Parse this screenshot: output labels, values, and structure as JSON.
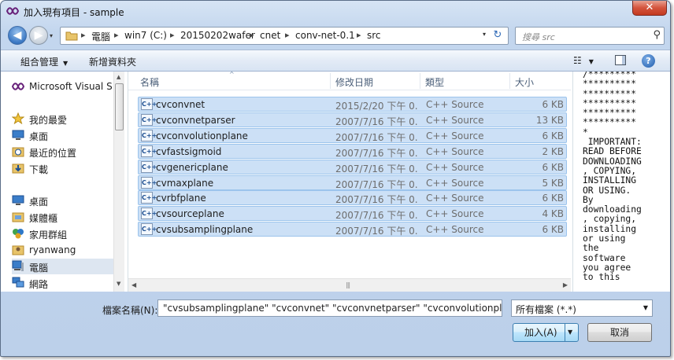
{
  "window": {
    "title": "加入現有項目 - sample",
    "close_glyph": "✕"
  },
  "navigation": {
    "back_glyph": "◀",
    "forward_glyph": "▶",
    "dropdown_glyph": "▾"
  },
  "address": {
    "segments": [
      "電腦",
      "win7 (C:)",
      "20150202wafer",
      "cnet",
      "conv-net-0.1",
      "src"
    ],
    "separator": "▸",
    "refresh_glyph": "↻",
    "dropdown_glyph": "▾"
  },
  "search": {
    "placeholder": "搜尋 src",
    "icon": "search-icon",
    "glyph": "⚲"
  },
  "toolbar": {
    "organize_label": "組合管理",
    "new_folder_label": "新增資料夾",
    "view_glyph": "☷",
    "dropdown_glyph": "▼",
    "help_glyph": "?"
  },
  "sidebar": {
    "items": [
      {
        "label": "Microsoft Visual S",
        "icon": "visual-studio-icon"
      },
      {
        "label": "我的最愛",
        "icon": "favorites-star-icon"
      },
      {
        "label": "桌面",
        "icon": "desktop-icon"
      },
      {
        "label": "最近的位置",
        "icon": "recent-places-icon"
      },
      {
        "label": "下載",
        "icon": "downloads-icon"
      },
      {
        "label": "桌面",
        "icon": "desktop-icon"
      },
      {
        "label": "媒體櫃",
        "icon": "libraries-icon"
      },
      {
        "label": "家用群組",
        "icon": "homegroup-icon"
      },
      {
        "label": "ryanwang",
        "icon": "user-folder-icon"
      },
      {
        "label": "電腦",
        "icon": "computer-icon"
      },
      {
        "label": "網路",
        "icon": "network-icon"
      }
    ]
  },
  "file_list": {
    "columns": {
      "name": "名稱",
      "date": "修改日期",
      "type": "類型",
      "size": "大小"
    },
    "rows": [
      {
        "name": "cvconvnet",
        "date": "2015/2/20 下午 0...",
        "type": "C++ Source",
        "size": "6 KB"
      },
      {
        "name": "cvconvnetparser",
        "date": "2007/7/16 下午 0...",
        "type": "C++ Source",
        "size": "13 KB"
      },
      {
        "name": "cvconvolutionplane",
        "date": "2007/7/16 下午 0...",
        "type": "C++ Source",
        "size": "6 KB"
      },
      {
        "name": "cvfastsigmoid",
        "date": "2007/7/16 下午 0...",
        "type": "C++ Source",
        "size": "2 KB"
      },
      {
        "name": "cvgenericplane",
        "date": "2007/7/16 下午 0...",
        "type": "C++ Source",
        "size": "6 KB"
      },
      {
        "name": "cvmaxplane",
        "date": "2007/7/16 下午 0...",
        "type": "C++ Source",
        "size": "5 KB"
      },
      {
        "name": "cvrbfplane",
        "date": "2007/7/16 下午 0...",
        "type": "C++ Source",
        "size": "6 KB"
      },
      {
        "name": "cvsourceplane",
        "date": "2007/7/16 下午 0...",
        "type": "C++ Source",
        "size": "4 KB"
      },
      {
        "name": "cvsubsamplingplane",
        "date": "2007/7/16 下午 0...",
        "type": "C++ Source",
        "size": "6 KB"
      }
    ],
    "file_icon_text": "C++",
    "sort_glyph": "^"
  },
  "preview": {
    "text": "/*********\n**********\n**********\n**********\n**********\n**********\n*\n IMPORTANT:\nREAD BEFORE\nDOWNLOADING\n, COPYING,\nINSTALLING\nOR USING.\nBy\ndownloading\n, copying,\ninstalling\nor using\nthe\nsoftware\nyou agree\nto this"
  },
  "bottom": {
    "filename_label": "檔案名稱(N):",
    "filename_value": "\"cvsubsamplingplane\" \"cvconvnet\" \"cvconvnetparser\" \"cvconvolutionplane\" \"cvfastsigmoid\" \"cvgenericplane\"",
    "filetype_value": "所有檔案 (*.*)",
    "open_label": "加入(A)",
    "cancel_label": "取消",
    "dropdown_glyph": "▼"
  },
  "colors": {
    "selection": "#cce0f6",
    "selection_border": "#9cc4ec",
    "toolbar": "#dce7f5",
    "frame": "#bcd0ea"
  }
}
